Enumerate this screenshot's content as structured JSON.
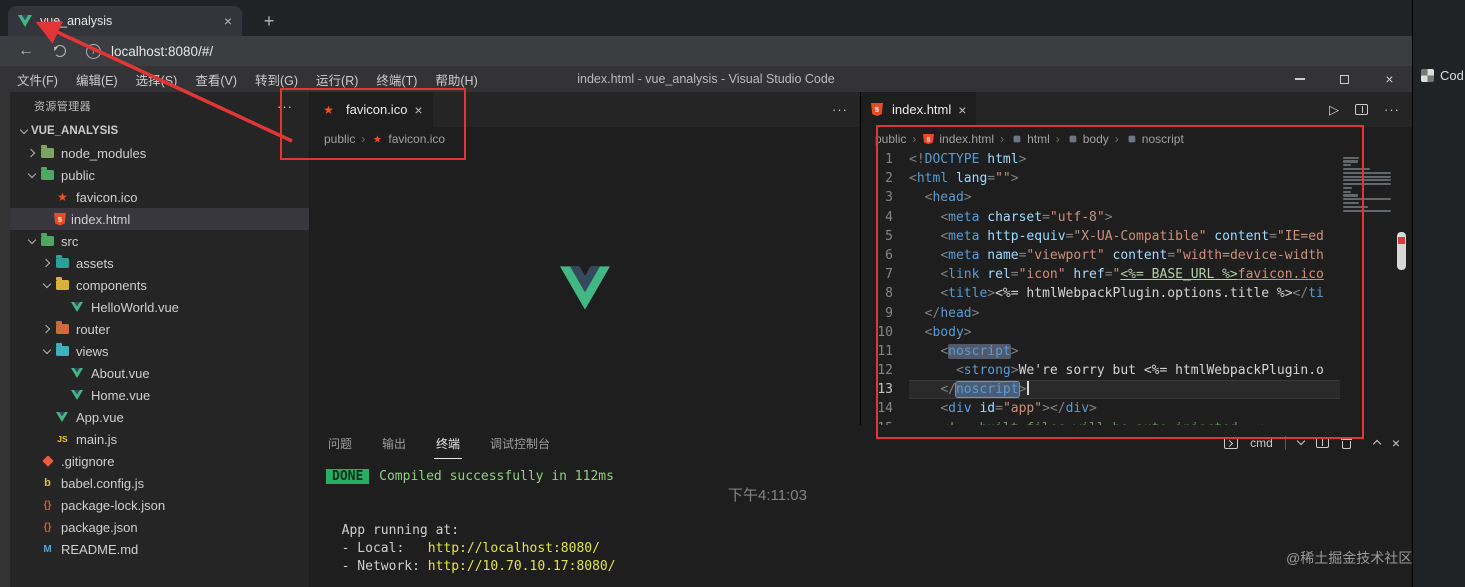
{
  "glyphs": {
    "close": "×",
    "more": "···",
    "play": "▷",
    "plus": "+",
    "back": "←",
    "info": "i",
    "separator": "›"
  },
  "browser": {
    "tab_title": "vue_analysis",
    "url": "localhost:8080/#/"
  },
  "vscode": {
    "window_title": "index.html - vue_analysis - Visual Studio Code",
    "menu": [
      "文件(F)",
      "编辑(E)",
      "选择(S)",
      "查看(V)",
      "转到(G)",
      "运行(R)",
      "终端(T)",
      "帮助(H)"
    ],
    "explorer": {
      "title": "资源管理器",
      "root": "VUE_ANALYSIS",
      "items": [
        {
          "label": "node_modules",
          "kind": "folder",
          "level": 1,
          "expanded": false
        },
        {
          "label": "public",
          "kind": "folder",
          "level": 1,
          "expanded": true
        },
        {
          "label": "favicon.ico",
          "kind": "file",
          "icon": "favicon-icon",
          "level": 2
        },
        {
          "label": "index.html",
          "kind": "file",
          "icon": "html-icon",
          "level": 2,
          "selected": true
        },
        {
          "label": "src",
          "kind": "folder",
          "level": 1,
          "expanded": true
        },
        {
          "label": "assets",
          "kind": "folder",
          "level": 2,
          "expanded": false
        },
        {
          "label": "components",
          "kind": "folder",
          "level": 2,
          "expanded": true
        },
        {
          "label": "HelloWorld.vue",
          "kind": "file",
          "icon": "vue-icon",
          "level": 3
        },
        {
          "label": "router",
          "kind": "folder",
          "level": 2,
          "expanded": false
        },
        {
          "label": "views",
          "kind": "folder",
          "level": 2,
          "expanded": true
        },
        {
          "label": "About.vue",
          "kind": "file",
          "icon": "vue-icon",
          "level": 3
        },
        {
          "label": "Home.vue",
          "kind": "file",
          "icon": "vue-icon",
          "level": 3
        },
        {
          "label": "App.vue",
          "kind": "file",
          "icon": "vue-icon",
          "level": 2
        },
        {
          "label": "main.js",
          "kind": "file",
          "icon": "js-icon",
          "level": 2
        },
        {
          "label": ".gitignore",
          "kind": "file",
          "icon": "git-icon",
          "level": 1
        },
        {
          "label": "babel.config.js",
          "kind": "file",
          "icon": "babel-icon",
          "level": 1
        },
        {
          "label": "package-lock.json",
          "kind": "file",
          "icon": "json-icon",
          "level": 1
        },
        {
          "label": "package.json",
          "kind": "file",
          "icon": "json-icon",
          "level": 1
        },
        {
          "label": "README.md",
          "kind": "file",
          "icon": "markdown-icon",
          "level": 1
        }
      ]
    },
    "editor_left": {
      "tab": "favicon.ico",
      "breadcrumb": [
        {
          "label": "public"
        },
        {
          "label": "favicon.ico",
          "icon": "favicon-icon"
        }
      ]
    },
    "editor_right": {
      "tab": "index.html",
      "current_line": 13,
      "breadcrumb": [
        {
          "label": "public"
        },
        {
          "label": "index.html",
          "icon": "html-icon"
        },
        {
          "label": "html",
          "icon": "symbol-icon"
        },
        {
          "label": "body",
          "icon": "symbol-icon"
        },
        {
          "label": "noscript",
          "icon": "symbol-icon"
        }
      ],
      "code": [
        [
          {
            "t": "<!",
            "c": "pt"
          },
          {
            "t": "DOCTYPE",
            "c": "tg"
          },
          {
            "t": " ",
            "c": "tx"
          },
          {
            "t": "html",
            "c": "at"
          },
          {
            "t": ">",
            "c": "pt"
          }
        ],
        [
          {
            "t": "<",
            "c": "pt"
          },
          {
            "t": "html",
            "c": "tg"
          },
          {
            "t": " ",
            "c": "tx"
          },
          {
            "t": "lang",
            "c": "at"
          },
          {
            "t": "=",
            "c": "pt"
          },
          {
            "t": "\"\"",
            "c": "st"
          },
          {
            "t": ">",
            "c": "pt"
          }
        ],
        [
          {
            "t": "  ",
            "c": "tx"
          },
          {
            "t": "<",
            "c": "pt"
          },
          {
            "t": "head",
            "c": "tg"
          },
          {
            "t": ">",
            "c": "pt"
          }
        ],
        [
          {
            "t": "    ",
            "c": "tx"
          },
          {
            "t": "<",
            "c": "pt"
          },
          {
            "t": "meta",
            "c": "tg"
          },
          {
            "t": " ",
            "c": "tx"
          },
          {
            "t": "charset",
            "c": "at"
          },
          {
            "t": "=",
            "c": "pt"
          },
          {
            "t": "\"utf-8\"",
            "c": "st"
          },
          {
            "t": ">",
            "c": "pt"
          }
        ],
        [
          {
            "t": "    ",
            "c": "tx"
          },
          {
            "t": "<",
            "c": "pt"
          },
          {
            "t": "meta",
            "c": "tg"
          },
          {
            "t": " ",
            "c": "tx"
          },
          {
            "t": "http-equiv",
            "c": "at"
          },
          {
            "t": "=",
            "c": "pt"
          },
          {
            "t": "\"X-UA-Compatible\"",
            "c": "st"
          },
          {
            "t": " ",
            "c": "tx"
          },
          {
            "t": "content",
            "c": "at"
          },
          {
            "t": "=",
            "c": "pt"
          },
          {
            "t": "\"IE=ed",
            "c": "st"
          }
        ],
        [
          {
            "t": "    ",
            "c": "tx"
          },
          {
            "t": "<",
            "c": "pt"
          },
          {
            "t": "meta",
            "c": "tg"
          },
          {
            "t": " ",
            "c": "tx"
          },
          {
            "t": "name",
            "c": "at"
          },
          {
            "t": "=",
            "c": "pt"
          },
          {
            "t": "\"viewport\"",
            "c": "st"
          },
          {
            "t": " ",
            "c": "tx"
          },
          {
            "t": "content",
            "c": "at"
          },
          {
            "t": "=",
            "c": "pt"
          },
          {
            "t": "\"width=device-width",
            "c": "st"
          }
        ],
        [
          {
            "t": "    ",
            "c": "tx"
          },
          {
            "t": "<",
            "c": "pt"
          },
          {
            "t": "link",
            "c": "tg"
          },
          {
            "t": " ",
            "c": "tx"
          },
          {
            "t": "rel",
            "c": "at"
          },
          {
            "t": "=",
            "c": "pt"
          },
          {
            "t": "\"icon\"",
            "c": "st"
          },
          {
            "t": " ",
            "c": "tx"
          },
          {
            "t": "href",
            "c": "at"
          },
          {
            "t": "=",
            "c": "pt"
          },
          {
            "t": "\"",
            "c": "st"
          },
          {
            "t": "<%= BASE_URL %>",
            "c": "tpl"
          },
          {
            "t": "favicon.ico",
            "c": "stu"
          }
        ],
        [
          {
            "t": "    ",
            "c": "tx"
          },
          {
            "t": "<",
            "c": "pt"
          },
          {
            "t": "title",
            "c": "tg"
          },
          {
            "t": ">",
            "c": "pt"
          },
          {
            "t": "<%= htmlWebpackPlugin.options.title %>",
            "c": "tx"
          },
          {
            "t": "</",
            "c": "pt"
          },
          {
            "t": "ti",
            "c": "tg"
          }
        ],
        [
          {
            "t": "  ",
            "c": "tx"
          },
          {
            "t": "</",
            "c": "pt"
          },
          {
            "t": "head",
            "c": "tg"
          },
          {
            "t": ">",
            "c": "pt"
          }
        ],
        [
          {
            "t": "  ",
            "c": "tx"
          },
          {
            "t": "<",
            "c": "pt"
          },
          {
            "t": "body",
            "c": "tg"
          },
          {
            "t": ">",
            "c": "pt"
          }
        ],
        [
          {
            "t": "    ",
            "c": "tx"
          },
          {
            "t": "<",
            "c": "pt"
          },
          {
            "t": "noscript",
            "c": "tg hl"
          },
          {
            "t": ">",
            "c": "pt"
          }
        ],
        [
          {
            "t": "      ",
            "c": "tx"
          },
          {
            "t": "<",
            "c": "pt"
          },
          {
            "t": "strong",
            "c": "tg"
          },
          {
            "t": ">",
            "c": "pt"
          },
          {
            "t": "We're sorry but ",
            "c": "tx"
          },
          {
            "t": "<%= htmlWebpackPlugin.o",
            "c": "tx"
          }
        ],
        [
          {
            "t": "    ",
            "c": "tx"
          },
          {
            "t": "</",
            "c": "pt"
          },
          {
            "t": "noscript",
            "c": "tg hls"
          },
          {
            "t": ">",
            "c": "pt"
          }
        ],
        [
          {
            "t": "    ",
            "c": "tx"
          },
          {
            "t": "<",
            "c": "pt"
          },
          {
            "t": "div",
            "c": "tg"
          },
          {
            "t": " ",
            "c": "tx"
          },
          {
            "t": "id",
            "c": "at"
          },
          {
            "t": "=",
            "c": "pt"
          },
          {
            "t": "\"app\"",
            "c": "st"
          },
          {
            "t": ">",
            "c": "pt"
          },
          {
            "t": "</",
            "c": "pt"
          },
          {
            "t": "div",
            "c": "tg"
          },
          {
            "t": ">",
            "c": "pt"
          }
        ],
        [
          {
            "t": "    ",
            "c": "tx"
          },
          {
            "t": "<!-- built files will be auto injected -->",
            "c": "cm"
          }
        ]
      ]
    },
    "panel": {
      "tabs": [
        "问题",
        "输出",
        "终端",
        "调试控制台"
      ],
      "active_tab": "终端",
      "shell": "cmd",
      "terminal": [
        {
          "badge": "DONE",
          "segs": [
            {
              "t": " Compiled successfully in 112ms",
              "c": "ok"
            }
          ]
        },
        {
          "segs": []
        },
        {
          "segs": []
        },
        {
          "segs": [
            {
              "t": "  App running at:",
              "c": "fg"
            }
          ]
        },
        {
          "segs": [
            {
              "t": "  - Local:   ",
              "c": "fg"
            },
            {
              "t": "http://localhost:8080/",
              "c": "url"
            }
          ]
        },
        {
          "segs": [
            {
              "t": "  - Network: ",
              "c": "fg"
            },
            {
              "t": "http://10.70.10.17:8080/",
              "c": "url"
            }
          ]
        }
      ]
    }
  },
  "side_panel": {
    "label": "Cod"
  },
  "watermarks": {
    "time": "下午4:11:03",
    "credit": "@稀土掘金技术社区"
  },
  "colors": {
    "annotation_red": "#e23636",
    "vue_green": "#41b883",
    "vue_dark": "#35495e",
    "done_green": "#27ae60"
  }
}
